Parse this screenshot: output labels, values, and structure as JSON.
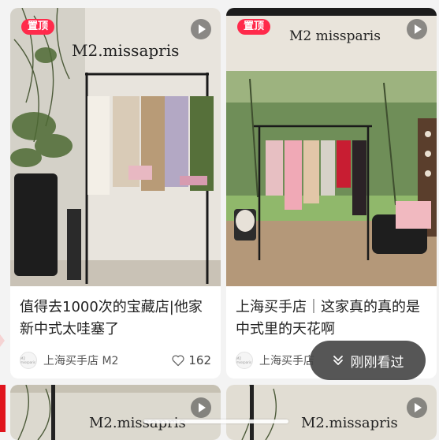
{
  "feed": {
    "cards": [
      {
        "badge": "置顶",
        "photo_text": "M2.missapris",
        "title": "值得去1000次的宝藏店|他家新中式太哇塞了",
        "shop": "上海买手店 M2",
        "avatar_text": "M2 missparis",
        "likes": "162"
      },
      {
        "badge": "置顶",
        "photo_text": "M2 missparis",
        "title": "上海买手店｜这家真的真的是中式里的天花啊",
        "shop": "上海买手店",
        "avatar_text": "M2 missparis"
      },
      {
        "photo_text": "M2.missapris"
      },
      {
        "photo_text": "M2.missapris"
      }
    ]
  },
  "toast": {
    "label": "刚刚看过"
  },
  "icons": [
    "play-icon",
    "heart-icon",
    "chevron-double-down-icon"
  ],
  "colors": {
    "badge": "#ff2a4b",
    "toast_bg": "#484848"
  }
}
